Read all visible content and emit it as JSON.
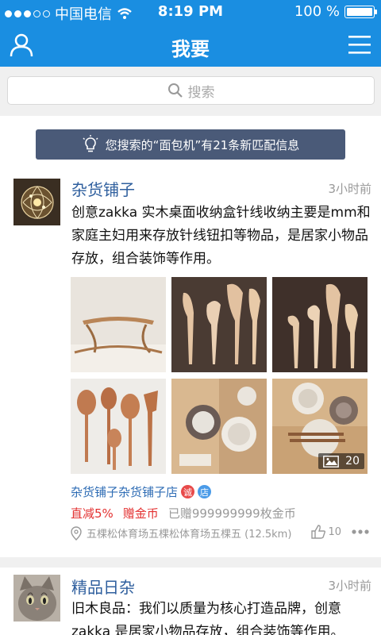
{
  "status_bar": {
    "carrier": "中国电信",
    "time": "8:19 PM",
    "battery": "100 %"
  },
  "nav": {
    "title": "我要"
  },
  "search": {
    "placeholder": "搜索"
  },
  "notice": {
    "text": "您搜索的“面包机”有21条新匹配信息"
  },
  "posts": [
    {
      "name": "杂货铺子",
      "time": "3小时前",
      "text": "创意zakka 实木桌面收纳盒针线收纳主要是mm和家庭主妇用来存放针线钮扣等物品，是居家小物品存放，组合装饰等作用。",
      "image_count": "20",
      "shop_name": "杂货铺子杂货铺子店",
      "shop_tags": [
        "诚",
        "店"
      ],
      "promo_discount": "直减5%",
      "promo_gift": "赠金币",
      "promo_given": "已赠999999999枚金币",
      "location": "五棵松体育场五棵松体育场五棵五 (12.5km)",
      "likes": "10"
    },
    {
      "name": "精品日杂",
      "time": "3小时前",
      "text": "旧木良品：我们以质量为核心打造品牌，创意zakka 是居家小物品存放，组合装饰等作用。"
    }
  ],
  "colors": {
    "primary": "#1a8ee1",
    "notice_bg": "#4a5a78",
    "name": "#2f5f9e",
    "promo": "#e33030",
    "tag_red": "#e84a4a",
    "tag_blue": "#4a9be8"
  }
}
